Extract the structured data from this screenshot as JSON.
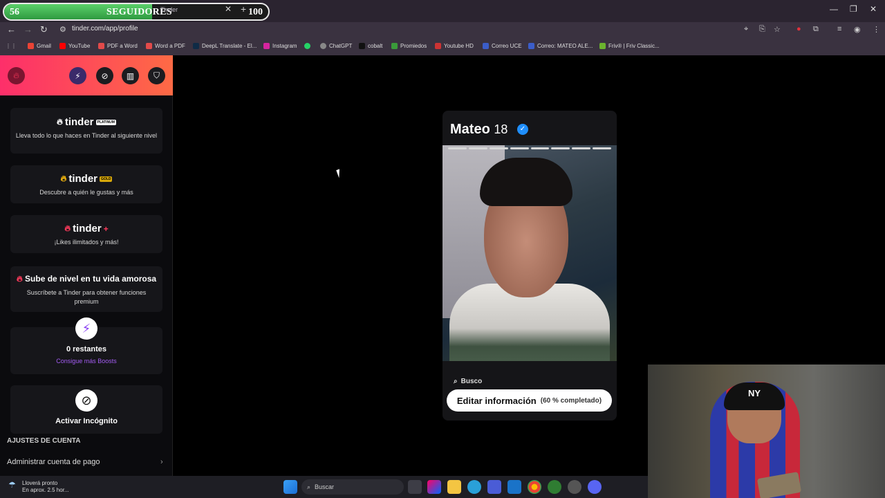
{
  "overlay": {
    "followers_current": "56",
    "followers_label": "SEGUIDORES",
    "followers_goal": "100",
    "followers_progress": 0.56
  },
  "browser": {
    "tab_title": "Tinder",
    "url": "tinder.com/app/profile",
    "bookmarks": [
      "Gmail",
      "YouTube",
      "PDF a Word",
      "Word a PDF",
      "DeepL Translate - El...",
      "Instagram",
      "ChatGPT",
      "cobalt",
      "Promiedos",
      "Youtube HD",
      "Correo UCE",
      "Correo: MATEO ALE...",
      "Friv® | Friv Classic..."
    ]
  },
  "sidebar": {
    "platinum": {
      "brand": "tinder",
      "tier": "PLATINUM",
      "desc": "Lleva todo lo que haces en Tinder al siguiente nivel"
    },
    "gold": {
      "brand": "tinder",
      "tier": "GOLD",
      "desc": "Descubre a quién le gustas y más"
    },
    "plus": {
      "brand": "tinder",
      "tier": "+",
      "desc": "¡Likes ilimitados y más!"
    },
    "upgrade": {
      "title": "Sube de nivel en tu vida amorosa",
      "desc": "Suscríbete a Tinder para obtener funciones premium"
    },
    "boosts": {
      "count": "0 restantes",
      "link": "Consigue más Boosts"
    },
    "incognito": {
      "label": "Activar Incógnito"
    },
    "settings_title": "AJUSTES DE CUENTA",
    "settings_row": "Administrar cuenta de pago"
  },
  "profile": {
    "name": "Mateo",
    "age": "18",
    "photo_count": 8,
    "busco": "Busco",
    "edit_label": "Editar información",
    "edit_progress": "(60 % completado)"
  },
  "taskbar": {
    "weather_title": "Lloverá pronto",
    "weather_sub": "En aprox. 2.5 hor...",
    "search": "Buscar"
  },
  "colors": {
    "brand_gradient_start": "#fd2f6a",
    "brand_gradient_end": "#fe6a45",
    "verified": "#1f8efb",
    "boost": "#8a3ff4"
  }
}
